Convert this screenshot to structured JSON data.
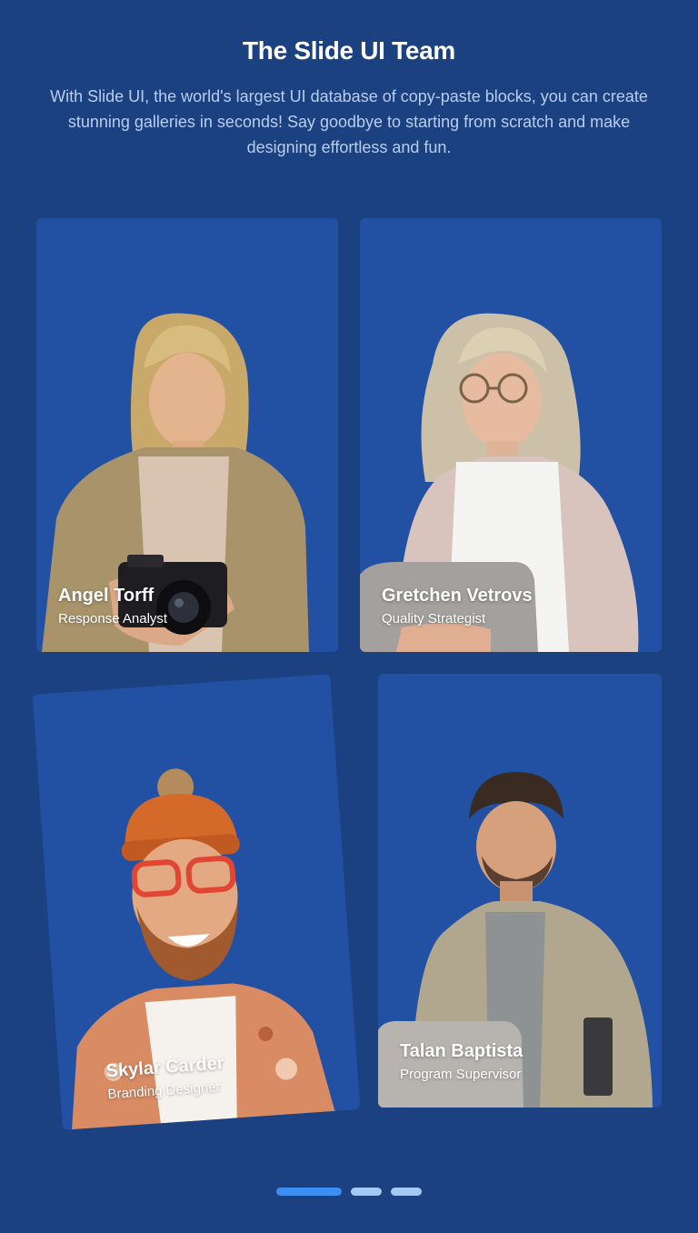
{
  "header": {
    "title": "The Slide UI Team",
    "description": "With Slide UI, the world's largest UI database of copy-paste blocks, you can create stunning galleries in seconds! Say goodbye to starting from scratch and make designing effortless and fun."
  },
  "team": [
    {
      "name": "Angel Torff",
      "role": "Response Analyst"
    },
    {
      "name": "Gretchen Vetrovs",
      "role": "Quality Strategist"
    },
    {
      "name": "Skylar Carder",
      "role": "Branding Designer"
    },
    {
      "name": "Talan Baptista",
      "role": "Program Supervisor"
    }
  ],
  "pagination": {
    "pages": 3,
    "active": 1
  },
  "colors": {
    "background": "#1c4180",
    "card": "#2251a4",
    "dot_active": "#3d8ef2",
    "dot_inactive": "#a6c8f5"
  }
}
